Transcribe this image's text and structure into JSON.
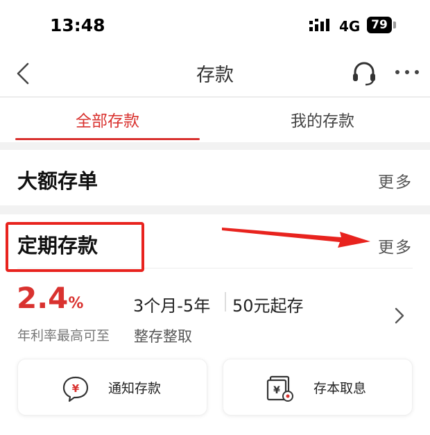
{
  "status_bar": {
    "time": "13:48",
    "network": "4G",
    "battery": "79"
  },
  "nav": {
    "title": "存款"
  },
  "tabs": [
    {
      "label": "全部存款"
    },
    {
      "label": "我的存款"
    }
  ],
  "sections": {
    "large_cd": {
      "title": "大额存单",
      "more": "更多"
    },
    "fixed": {
      "title": "定期存款",
      "more": "更多",
      "rate_value": "2.4",
      "rate_unit": "%",
      "rate_label": "年利率最高可至",
      "term": "3个月-5年",
      "min_amount": "50元起存",
      "deposit_type": "整存整取"
    }
  },
  "cards": [
    {
      "label": "通知存款"
    },
    {
      "label": "存本取息"
    }
  ],
  "colors": {
    "accent": "#d9322f",
    "annotation": "#e8231e"
  }
}
